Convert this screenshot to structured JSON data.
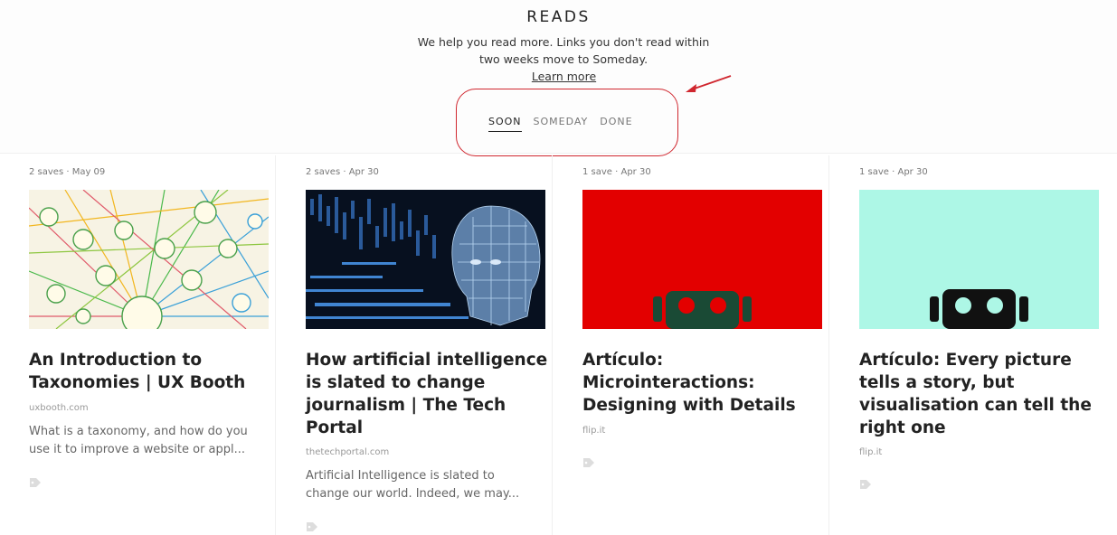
{
  "header": {
    "title": "READS",
    "subtitle": "We help you read more. Links you don't read within two weeks move to Someday.",
    "learn_more": "Learn more"
  },
  "tabs": [
    {
      "label": "SOON",
      "active": true
    },
    {
      "label": "SOMEDAY",
      "active": false
    },
    {
      "label": "DONE",
      "active": false
    }
  ],
  "cards": [
    {
      "meta": "2 saves · May 09",
      "title": "An Introduction to Taxonomies | UX Booth",
      "domain": "uxbooth.com",
      "excerpt": "What is a taxonomy, and how do you use it to improve a website or appl...",
      "image": "taxonomy-map"
    },
    {
      "meta": "2 saves · Apr 30",
      "title": "How artificial intelligence is slated to change journalism | The Tech Portal",
      "domain": "thetechportal.com",
      "excerpt": "Artificial Intelligence is slated to change our world. Indeed, we may...",
      "image": "digital-head"
    },
    {
      "meta": "1 save · Apr 30",
      "title": "Artículo: Microinteractions: Designing with Details",
      "domain": "flip.it",
      "excerpt": "",
      "image": "robot-red",
      "image_bg": "#e30000"
    },
    {
      "meta": "1 save · Apr 30",
      "title": "Artículo: Every picture tells a story, but visualisation can tell the right one",
      "domain": "flip.it",
      "excerpt": "",
      "image": "robot-mint",
      "image_bg": "#adf7e6"
    }
  ],
  "colors": {
    "annotation_red": "#d0272f",
    "text_dark": "#222222",
    "text_muted": "#777777"
  }
}
